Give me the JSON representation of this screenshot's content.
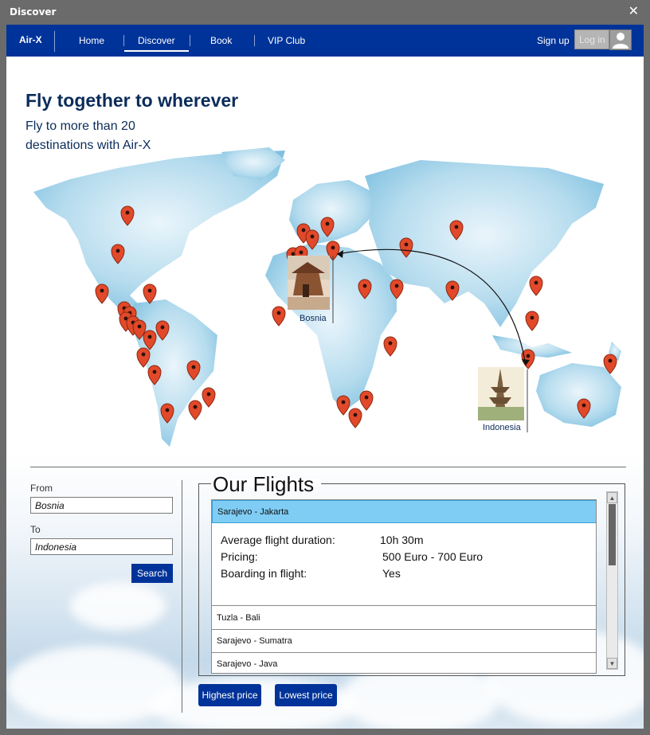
{
  "window": {
    "title": "Discover",
    "close_glyph": "✕"
  },
  "nav": {
    "brand": "Air-X",
    "items": [
      "Home",
      "Discover",
      "Book",
      "VIP Club"
    ],
    "active": "Discover",
    "signup": "Sign up",
    "login": "Log in",
    "bg_color": "#003399"
  },
  "hero": {
    "title": "Fly together to wherever",
    "subtitle": "Fly to more than 20 destinations with Air-X"
  },
  "map": {
    "origin_label": "Bosnia",
    "destination_label": "Indonesia",
    "pin_color": "#e2492a"
  },
  "search": {
    "from_label": "From",
    "from_value": "Bosnia",
    "to_label": "To",
    "to_value": "Indonesia",
    "button": "Search"
  },
  "flights": {
    "title": "Our Flights",
    "selected": "Sarajevo - Jakarta",
    "details": [
      {
        "key": "Average flight duration:",
        "value": "10h 30m"
      },
      {
        "key": "Pricing:",
        "value": "500 Euro - 700 Euro"
      },
      {
        "key": "Boarding in flight:",
        "value": "Yes"
      }
    ],
    "others": [
      "Tuzla - Bali",
      "Sarajevo - Sumatra",
      "Sarajevo - Java"
    ],
    "highlight_color": "#7fcdf5"
  },
  "buttons": {
    "highest": "Highest price",
    "lowest": "Lowest price"
  }
}
